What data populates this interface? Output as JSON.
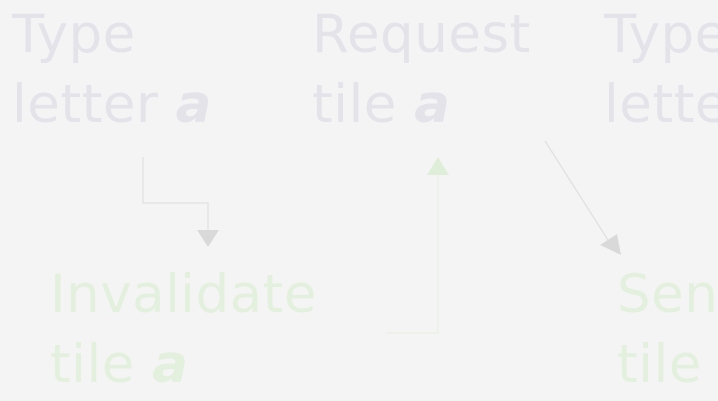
{
  "diagram": {
    "nodes": [
      {
        "id": "type-letter-1",
        "kind": "client",
        "line1": "Type",
        "line2_text": "letter ",
        "line2_var": "a"
      },
      {
        "id": "request-tile",
        "kind": "client",
        "line1": "Request",
        "line2_text": "tile ",
        "line2_var": "a"
      },
      {
        "id": "type-letter-2",
        "kind": "client",
        "line1": "Type",
        "line2_text": "lette",
        "line2_var": ""
      },
      {
        "id": "invalidate-tile",
        "kind": "server",
        "line1": "Invalidate",
        "line2_text": "tile ",
        "line2_var": "a"
      },
      {
        "id": "send-tile",
        "kind": "server",
        "line1": "Sen",
        "line2_text": "tile",
        "line2_var": ""
      }
    ],
    "edges": [
      {
        "from": "type-letter-1",
        "to": "invalidate-tile"
      },
      {
        "from": "invalidate-tile",
        "to": "request-tile"
      },
      {
        "from": "request-tile",
        "to": "send-tile"
      }
    ],
    "colors": {
      "background": "#f4f4f4",
      "client_text": "#e4e3ea",
      "server_text": "#e3f0de",
      "arrow_gray": "#d9d9d9",
      "arrow_line_gray": "#e0e0e0",
      "arrow_green": "#dfeed9"
    }
  }
}
